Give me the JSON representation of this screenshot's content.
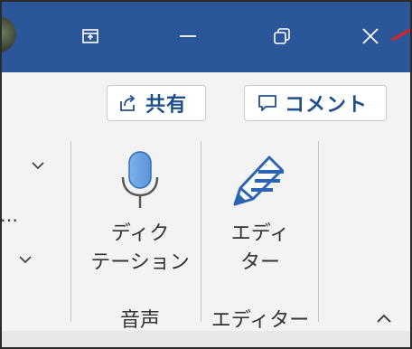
{
  "titlebar": {
    "background": "#2b579a",
    "buttons": [
      {
        "name": "ribbon-display-options",
        "icon": "ribbon-display-icon"
      },
      {
        "name": "minimize",
        "icon": "minimize-icon"
      },
      {
        "name": "restore",
        "icon": "restore-icon"
      },
      {
        "name": "close",
        "icon": "close-icon"
      }
    ]
  },
  "commands": {
    "share_label": "共有",
    "share_icon": "share-icon",
    "comment_label": "コメント",
    "comment_icon": "comment-icon",
    "accent": "#1f4e8c"
  },
  "ribbon": {
    "left_partial": {
      "line1": "⋯",
      "line2": "…"
    },
    "dictate": {
      "label_line1": "ディク",
      "label_line2": "テーション",
      "icon": "microphone-icon"
    },
    "editor": {
      "label_line1": "エディ",
      "label_line2": "ター",
      "icon": "editor-pen-icon"
    },
    "groups": {
      "voice": "音声",
      "editor": "エディター"
    },
    "collapse_icon": "chevron-up-icon"
  },
  "annotation": {
    "arrow_color": "#e02020"
  }
}
